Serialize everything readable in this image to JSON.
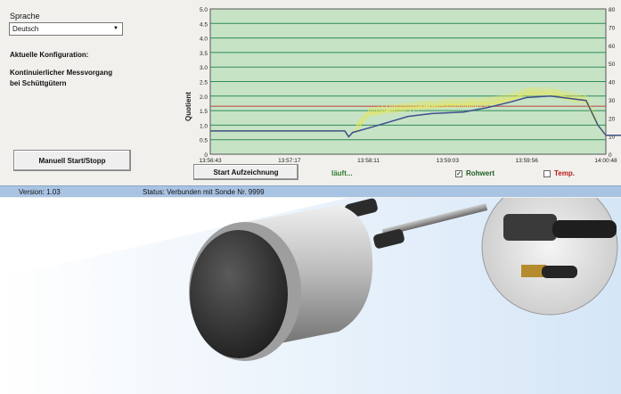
{
  "left_panel": {
    "language_label": "Sprache",
    "language_value": "Deutsch",
    "config_title": "Aktuelle Konfiguration:",
    "config_line1": "Kontinuierlicher Messvorgang",
    "config_line2": "bei Schüttgütern",
    "manual_button": "Manuell Start/Stopp"
  },
  "controls": {
    "record_button": "Start Aufzeichnung",
    "running_text": "läuft...",
    "raw_label": "Rohwert",
    "raw_checked": true,
    "temp_label": "Temp.",
    "temp_checked": false
  },
  "status_bar": {
    "version": "Version: 1.03",
    "status": "Status: Verbunden mit Sonde Nr. 9999"
  },
  "colors": {
    "plot_bg": "#c6e3c6",
    "grid": "#2e8b57",
    "quotient_line": "#3d4f8c",
    "raw_line": "#e6e65a",
    "temp_line": "#c0504d"
  },
  "chart_data": {
    "type": "line",
    "ylabel": "Quotient",
    "ylim": [
      0,
      5
    ],
    "y_ticks": [
      "0",
      "0.5",
      "1.0",
      "1.5",
      "2.0",
      "2.5",
      "3.0",
      "3.5",
      "4.0",
      "4.5",
      "5.0"
    ],
    "y2_ticks": [
      "0",
      "10",
      "20",
      "30",
      "40",
      "50",
      "60",
      "70",
      "80"
    ],
    "y2lim": [
      0,
      80
    ],
    "x_ticks": [
      "13:56:43",
      "13:57:17",
      "13:58:11",
      "13:59:03",
      "13:59:56",
      "14:00:48"
    ],
    "grid": true,
    "series": [
      {
        "key": "quotient",
        "points": [
          [
            0,
            0.8
          ],
          [
            1,
            0.8
          ],
          [
            1.7,
            0.8
          ],
          [
            1.75,
            0.6
          ],
          [
            1.8,
            0.75
          ],
          [
            2,
            0.9
          ],
          [
            2.5,
            1.3
          ],
          [
            2.8,
            1.4
          ],
          [
            3.2,
            1.45
          ],
          [
            3.5,
            1.6
          ],
          [
            3.8,
            1.8
          ],
          [
            4.0,
            1.95
          ],
          [
            4.3,
            2.0
          ],
          [
            4.6,
            1.9
          ],
          [
            4.75,
            1.85
          ],
          [
            4.9,
            1.0
          ],
          [
            5.0,
            0.65
          ],
          [
            6,
            0.65
          ]
        ]
      },
      {
        "key": "raw",
        "points": [
          [
            0,
            0.8
          ],
          [
            1,
            0.8
          ],
          [
            1.7,
            0.8
          ],
          [
            1.75,
            0.6
          ],
          [
            1.85,
            0.9
          ],
          [
            2.0,
            1.4
          ],
          [
            2.5,
            1.6
          ],
          [
            3.0,
            1.7
          ],
          [
            3.5,
            1.75
          ],
          [
            3.8,
            1.9
          ],
          [
            4.0,
            2.1
          ],
          [
            4.3,
            2.1
          ],
          [
            4.6,
            1.9
          ],
          [
            4.75,
            1.85
          ],
          [
            4.9,
            1.0
          ],
          [
            5.0,
            0.65
          ],
          [
            6,
            0.65
          ]
        ]
      },
      {
        "key": "temperature",
        "points": [
          [
            0,
            0.8
          ],
          [
            1,
            0.8
          ],
          [
            1.7,
            0.8
          ],
          [
            1.75,
            0.6
          ],
          [
            1.8,
            0.75
          ],
          [
            2,
            0.9
          ],
          [
            2.5,
            1.3
          ],
          [
            2.8,
            1.4
          ],
          [
            3.2,
            1.45
          ],
          [
            3.5,
            1.6
          ],
          [
            3.8,
            1.8
          ],
          [
            4.0,
            1.95
          ],
          [
            4.3,
            2.0
          ],
          [
            4.6,
            1.9
          ],
          [
            4.75,
            1.85
          ],
          [
            4.9,
            1.0
          ],
          [
            5.0,
            0.65
          ],
          [
            6,
            0.65
          ]
        ]
      }
    ],
    "temperature_level": 1.65
  }
}
